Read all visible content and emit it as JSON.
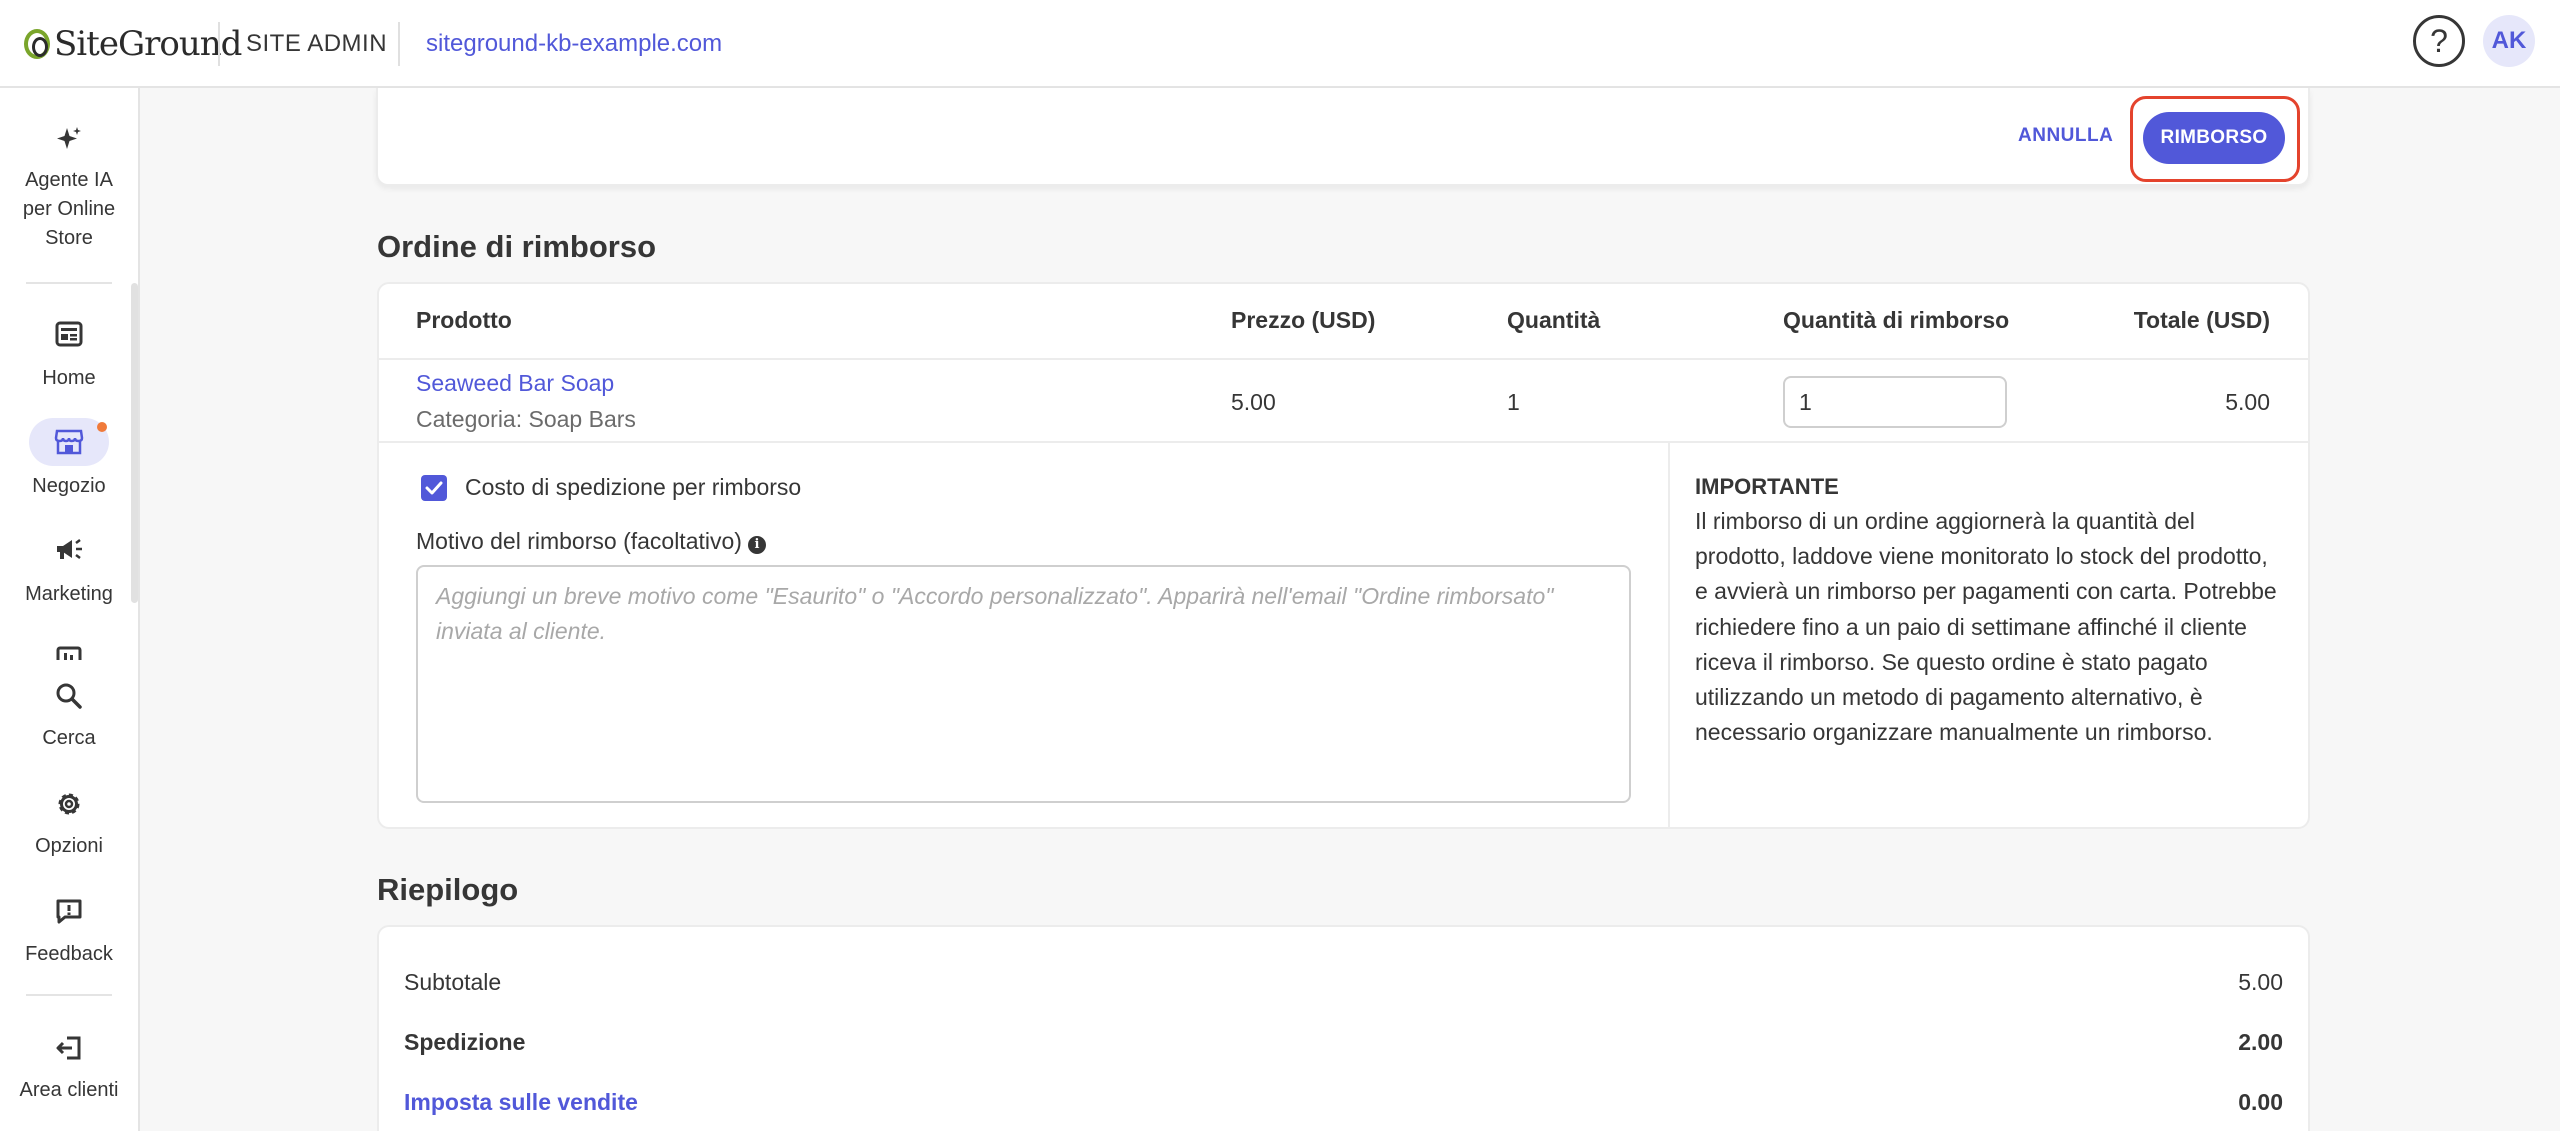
{
  "header": {
    "logo_text": "SiteGround",
    "section": "SITE ADMIN",
    "domain": "siteground-kb-example.com",
    "help_glyph": "?",
    "avatar_initials": "AK"
  },
  "sidebar": {
    "items": [
      {
        "label": "Agente IA per Online Store",
        "icon": "sparkle-icon"
      },
      {
        "label": "Home",
        "icon": "dashboard-icon"
      },
      {
        "label": "Negozio",
        "icon": "store-icon"
      },
      {
        "label": "Marketing",
        "icon": "megaphone-icon"
      },
      {
        "label": "Cerca",
        "icon": "search-icon"
      },
      {
        "label": "Opzioni",
        "icon": "gear-icon"
      },
      {
        "label": "Feedback",
        "icon": "feedback-icon"
      },
      {
        "label": "Area clienti",
        "icon": "logout-icon"
      }
    ]
  },
  "actions": {
    "cancel": "ANNULLA",
    "refund": "RIMBORSO"
  },
  "order": {
    "title": "Ordine di rimborso",
    "columns": [
      "Prodotto",
      "Prezzo (USD)",
      "Quantità",
      "Quantità di rimborso",
      "Totale (USD)"
    ],
    "product": {
      "name": "Seaweed Bar Soap",
      "category": "Categoria: Soap Bars",
      "price": "5.00",
      "quantity": "1",
      "refund_quantity": "1",
      "total": "5.00"
    },
    "shipping_checkbox_label": "Costo di spedizione per rimborso",
    "shipping_checked": true,
    "reason_label": "Motivo del rimborso (facoltativo)",
    "reason_placeholder": "Aggiungi un breve motivo come \"Esaurito\" o \"Accordo personalizzato\". Apparirà nell'email \"Ordine rimborsato\" inviata al cliente.",
    "important_title": "IMPORTANTE",
    "important_text": "Il rimborso di un ordine aggiornerà la quantità del prodotto, laddove viene monitorato lo stock del prodotto, e avvierà un rimborso per pagamenti con carta. Potrebbe richiedere fino a un paio di settimane affinché il cliente riceva il rimborso. Se questo ordine è stato pagato utilizzando un metodo di pagamento alternativo, è necessario organizzare manualmente un rimborso."
  },
  "summary": {
    "title": "Riepilogo",
    "rows": [
      {
        "label": "Subtotale",
        "value": "5.00"
      },
      {
        "label": "Spedizione",
        "value": "2.00"
      },
      {
        "label": "Imposta sulle vendite",
        "value": "0.00"
      }
    ]
  },
  "colors": {
    "accent": "#5158d9",
    "highlight": "#e4432d",
    "notification": "#f07a3a",
    "logo_green": "#7aa52b"
  }
}
